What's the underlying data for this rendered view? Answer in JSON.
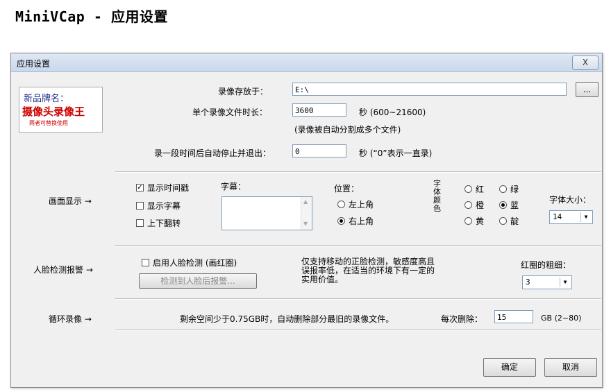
{
  "page_title": "MiniVCap - 应用设置",
  "dialog": {
    "title": "应用设置",
    "close_glyph": "X"
  },
  "brand": {
    "line1": "新品牌名：",
    "line2": "摄像头录像王",
    "line3": "两者可替换使用"
  },
  "side_labels": {
    "display": "画面显示 →",
    "face": "人脸检测报警 →",
    "loop": "循环录像 →"
  },
  "storage": {
    "save_label": "录像存放于：",
    "save_path": "E:\\",
    "browse_label": "...",
    "duration_label": "单个录像文件时长：",
    "duration_value": "3600",
    "duration_unit": "秒 (600~21600)",
    "duration_note": "(录像被自动分割成多个文件)",
    "autostop_label": "录一段时间后自动停止并退出：",
    "autostop_value": "0",
    "autostop_unit": "秒 (“0”表示一直录)"
  },
  "display": {
    "show_time_label": "显示时间戳",
    "show_time_checked": true,
    "show_caption_label": "显示字幕",
    "show_caption_checked": false,
    "flip_label": "上下翻转",
    "flip_checked": false,
    "caption_label": "字幕：",
    "position_label": "位置：",
    "pos_topleft": "左上角",
    "pos_topright": "右上角",
    "position_selected": "右上角",
    "font_color_label": "字体颜色",
    "colors": [
      "红",
      "绿",
      "橙",
      "蓝",
      "黄",
      "靛"
    ],
    "color_selected": "蓝",
    "font_size_label": "字体大小：",
    "font_size_value": "14"
  },
  "face": {
    "enable_label": "启用人脸检测 (画红圈)",
    "enable_checked": false,
    "alarm_button": "检测到人脸后报警...",
    "note": "仅支持移动的正脸检测，敏感度高且误报率低，在适当的环境下有一定的实用价值。",
    "circle_label": "红圈的粗细：",
    "circle_value": "3"
  },
  "loop": {
    "desc": "剩余空间少于0.75GB时，自动删除部分最旧的录像文件。",
    "delete_label": "每次删除：",
    "delete_value": "15",
    "delete_unit": "GB (2~80)"
  },
  "footer": {
    "ok": "确定",
    "cancel": "取消"
  }
}
